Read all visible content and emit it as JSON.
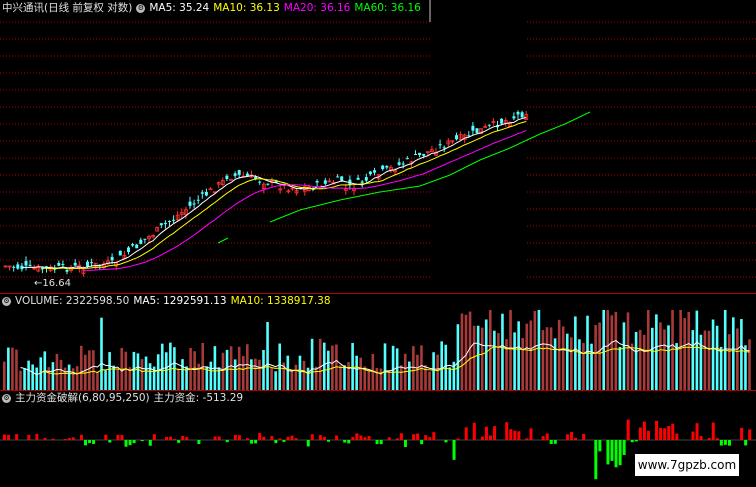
{
  "price_header": {
    "title": "中兴通讯(日线 前复权 对数)",
    "ma5": "MA5: 35.24",
    "ma10": "MA10: 36.13",
    "ma20": "MA20: 36.16",
    "ma60": "MA60: 36.16"
  },
  "low_label": "16.64",
  "volume_header": {
    "vol": "VOLUME: 2322598.50",
    "ma5": "MA5: 1292591.13",
    "ma10": "MA10: 1338917.38"
  },
  "flow_header": {
    "title": "主力资金破解(6,80,95,250)",
    "value": "主力资金: -513.29"
  },
  "watermark": "www.7gpzb.com",
  "colors": {
    "up": "#ff3232",
    "down": "#54ffff",
    "vol_up": "#a83a3a",
    "ma5": "#ffffff",
    "ma10": "#ffff00",
    "ma20": "#ff00ff",
    "ma60": "#00ff00",
    "flow_pos": "#ff0000",
    "flow_neg": "#00ff00",
    "grid": "#b00000"
  }
}
